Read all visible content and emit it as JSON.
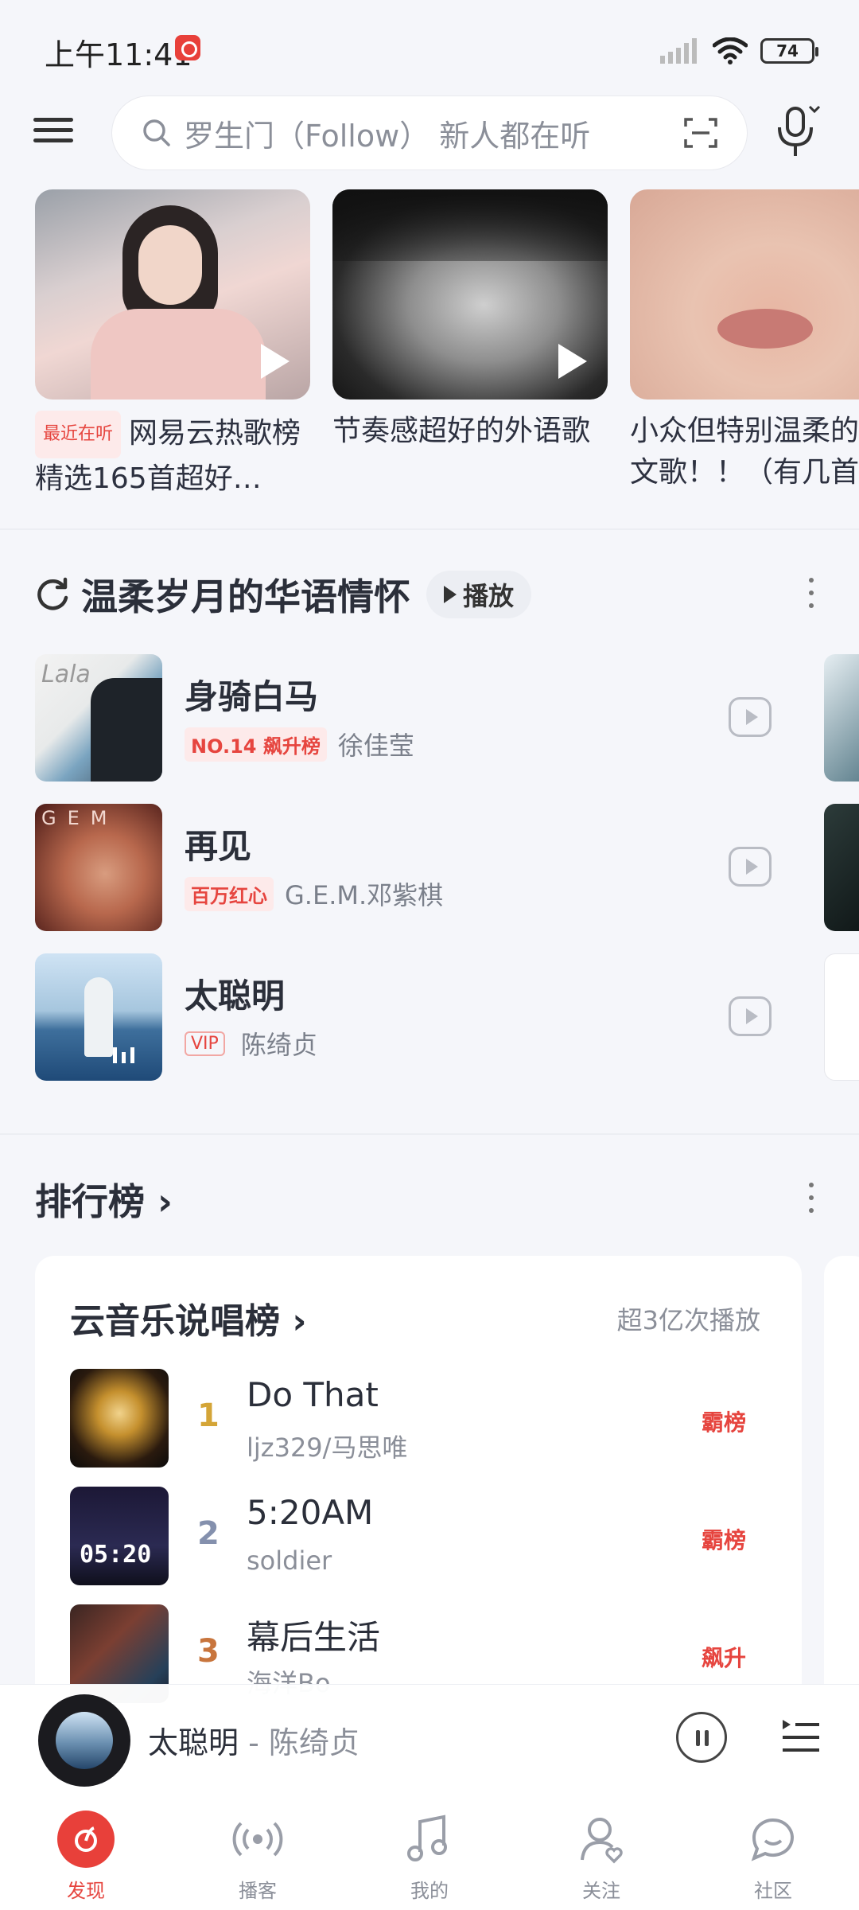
{
  "status_bar": {
    "time": "上午11:41",
    "battery": "74"
  },
  "search": {
    "placeholder": "罗生门（Follow） 新人都在听"
  },
  "top_playlists": [
    {
      "tag": "最近在听",
      "title": "网易云热歌榜精选165首超好…"
    },
    {
      "title": "节奏感超好的外语歌"
    },
    {
      "title": "小众但特别温柔的文歌！！（有几首"
    }
  ],
  "recommend": {
    "title": "温柔岁月的华语情怀",
    "play_label": "播放",
    "songs": [
      {
        "name": "身骑白马",
        "badge": "NO.14 飙升榜",
        "artist": "徐佳莹"
      },
      {
        "name": "再见",
        "badge": "百万红心",
        "artist": "G.E.M.邓紫棋"
      },
      {
        "name": "太聪明",
        "badge": "VIP",
        "artist": "陈绮贞"
      }
    ]
  },
  "rankings": {
    "header": "排行榜",
    "chart": {
      "title": "云音乐说唱榜",
      "subtitle": "超3亿次播放",
      "entries": [
        {
          "rank": "1",
          "song": "Do That",
          "artist": "ljz329/马思唯",
          "tag": "霸榜",
          "rank_color": "#d4a537"
        },
        {
          "rank": "2",
          "song": "5:20AM",
          "artist": "soldier",
          "tag": "霸榜",
          "rank_color": "#8490ad"
        },
        {
          "rank": "3",
          "song": "幕后生活",
          "artist": "海洋Bo",
          "tag": "飙升",
          "rank_color": "#c8753d"
        }
      ]
    },
    "cover_text_2": "05:20"
  },
  "player": {
    "title": "太聪明",
    "separator": " - ",
    "artist": "陈绮贞"
  },
  "nav": [
    {
      "label": "发现",
      "icon": "discover-icon"
    },
    {
      "label": "播客",
      "icon": "podcast-icon"
    },
    {
      "label": "我的",
      "icon": "music-note-icon"
    },
    {
      "label": "关注",
      "icon": "follow-icon"
    },
    {
      "label": "社区",
      "icon": "community-icon"
    }
  ],
  "colors": {
    "accent": "#e8403a",
    "background": "#f5f6fa"
  }
}
